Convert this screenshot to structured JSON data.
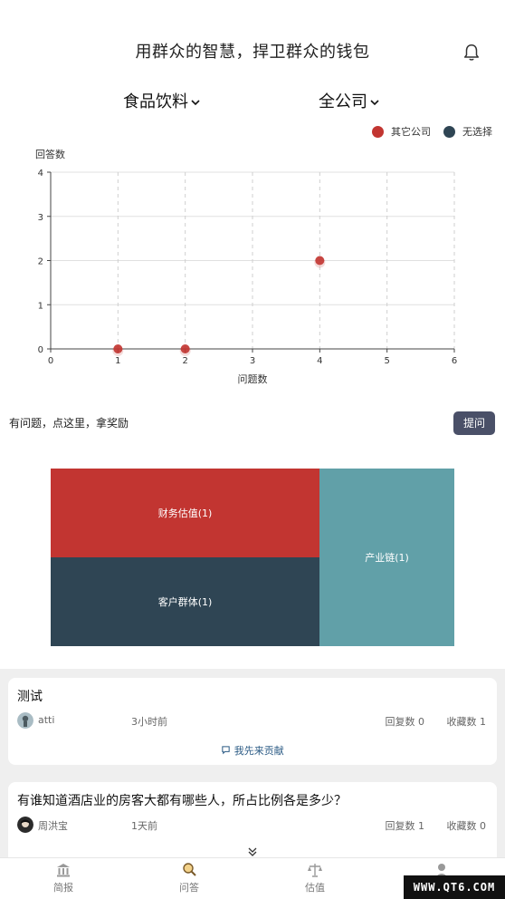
{
  "header": {
    "title": "用群众的智慧，捍卫群众的钱包",
    "bell_icon": "bell-icon"
  },
  "filters": {
    "category": "食品饮料",
    "company": "全公司"
  },
  "legend": [
    {
      "label": "其它公司",
      "color": "#c23531"
    },
    {
      "label": "无选择",
      "color": "#2f4554"
    }
  ],
  "chart_data": {
    "type": "scatter",
    "xlabel": "问题数",
    "ylabel": "回答数",
    "xlim": [
      0,
      6
    ],
    "ylim": [
      0,
      4
    ],
    "x_ticks": [
      0,
      1,
      2,
      3,
      4,
      5,
      6
    ],
    "y_ticks": [
      0,
      1,
      2,
      3,
      4
    ],
    "grid": true,
    "legend_position": "top-right",
    "series": [
      {
        "name": "其它公司",
        "color": "#c23531",
        "points": [
          [
            1,
            0
          ],
          [
            2,
            0
          ],
          [
            4,
            2
          ]
        ]
      }
    ]
  },
  "ask": {
    "prompt": "有问题，点这里，拿奖励",
    "button": "提问"
  },
  "treemap": {
    "valuation": "财务估值(1)",
    "customers": "客户群体(1)",
    "chain": "产业链(1)"
  },
  "feed": [
    {
      "title": "测试",
      "user": "atti",
      "time": "3小时前",
      "replies": "回复数  0",
      "favorites": "收藏数  1",
      "contribute": "我先来贡献"
    },
    {
      "title": "有谁知道酒店业的房客大都有哪些人，所占比例各是多少？",
      "user": "周洪宝",
      "time": "1天前",
      "replies": "回复数  1",
      "favorites": "收藏数  0"
    }
  ],
  "tabs": {
    "news": "简报",
    "qa": "问答",
    "valuation": "估值"
  },
  "watermark": "WWW.QT6.COM"
}
